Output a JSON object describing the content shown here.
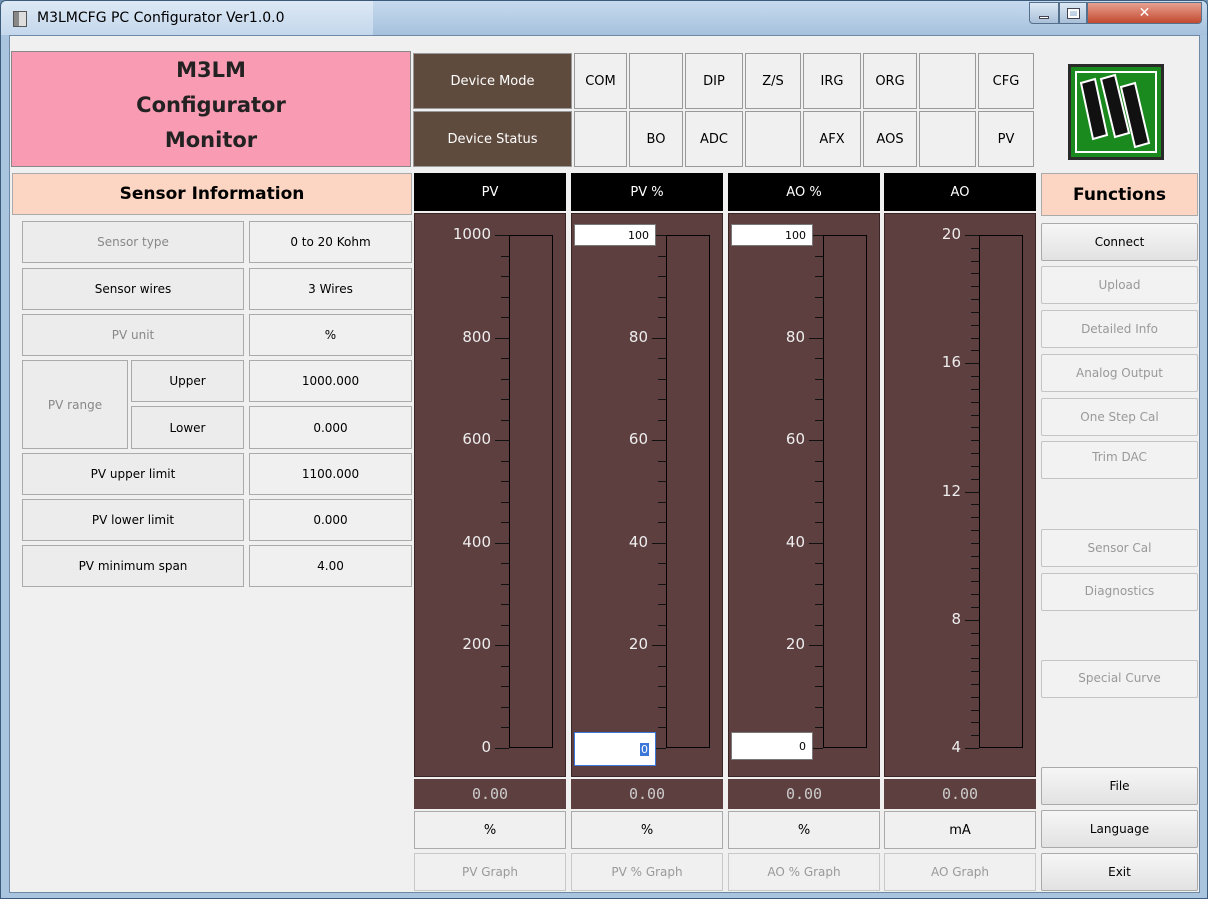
{
  "window": {
    "title": "M3LMCFG PC Configurator Ver1.0.0"
  },
  "header": {
    "line1": "M3LM",
    "line2": "Configurator",
    "line3": "Monitor"
  },
  "device": {
    "mode_label": "Device Mode",
    "status_label": "Device Status",
    "mode_flags": [
      "COM",
      "",
      "DIP",
      "Z/S",
      "IRG",
      "ORG",
      "",
      "CFG"
    ],
    "status_flags": [
      "",
      "BO",
      "ADC",
      "",
      "AFX",
      "AOS",
      "",
      "PV"
    ]
  },
  "sensor": {
    "title": "Sensor Information",
    "type_label": "Sensor type",
    "type_value": "0 to 20 Kohm",
    "wires_label": "Sensor wires",
    "wires_value": "3 Wires",
    "unit_label": "PV unit",
    "unit_value": "%",
    "range_label": "PV range",
    "upper_label": "Upper",
    "upper_value": "1000.000",
    "lower_label": "Lower",
    "lower_value": "0.000",
    "upper_limit_label": "PV upper limit",
    "upper_limit_value": "1100.000",
    "lower_limit_label": "PV lower limit",
    "lower_limit_value": "0.000",
    "min_span_label": "PV minimum span",
    "min_span_value": "4.00"
  },
  "graphs": [
    {
      "title": "PV",
      "ticks": [
        "1000",
        "800",
        "600",
        "400",
        "200",
        "0"
      ],
      "value": "0.00",
      "unit": "%",
      "button": "PV Graph",
      "level": 0
    },
    {
      "title": "PV %",
      "ticks": [
        "80",
        "60",
        "40",
        "20"
      ],
      "top_input": "100",
      "bottom_input": "0",
      "value": "0.00",
      "unit": "%",
      "button": "PV % Graph",
      "level": 0
    },
    {
      "title": "AO %",
      "ticks": [
        "80",
        "60",
        "40",
        "20"
      ],
      "top_input": "100",
      "bottom_input": "0",
      "value": "0.00",
      "unit": "%",
      "button": "AO % Graph",
      "level": 0
    },
    {
      "title": "AO",
      "ticks": [
        "20",
        "16",
        "12",
        "8",
        "4"
      ],
      "value": "0.00",
      "unit": "mA",
      "button": "AO Graph",
      "level": 0
    }
  ],
  "functions": {
    "title": "Functions",
    "connect": "Connect",
    "upload": "Upload",
    "detailed": "Detailed Info",
    "analog": "Analog Output",
    "onestep": "One Step Cal",
    "trimdac": "Trim DAC",
    "sensorcal": "Sensor Cal",
    "diagnostics": "Diagnostics",
    "special": "Special Curve",
    "file": "File",
    "language": "Language",
    "exit": "Exit"
  },
  "colors": {
    "header_pink": "#f99bb3",
    "graph_bg": "#5e3f40",
    "section_peach": "#fcd6c2",
    "logo_green": "#1a8a1f"
  }
}
